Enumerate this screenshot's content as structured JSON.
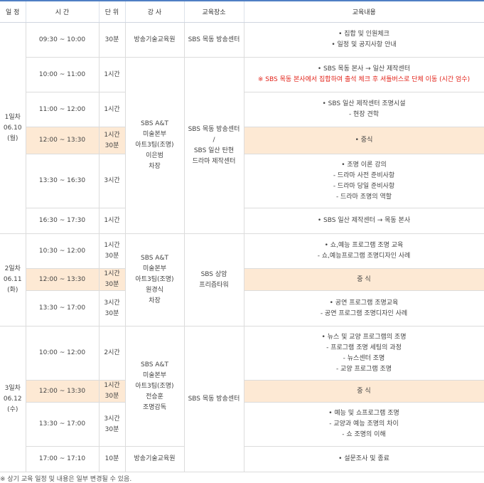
{
  "headers": {
    "day": "일 정",
    "time": "시 간",
    "unit": "단 위",
    "instructor": "강 사",
    "location": "교육장소",
    "content": "교육내용"
  },
  "day1": {
    "day_lines": [
      "1일차",
      "06.10",
      "(월)"
    ],
    "rows": [
      {
        "time": "09:30 ~ 10:00",
        "unit_lines": [
          "30분"
        ],
        "content": [
          "• 집합 및 인원체크",
          "• 일정 및 공지사항 안내"
        ]
      },
      {
        "time": "10:00 ~ 11:00",
        "unit_lines": [
          "1시간"
        ],
        "content": [
          "• SBS 목동 본사 → 일산 제작센터"
        ],
        "content_red": "※ SBS 목동 본사에서 집합하여 출석 체크 후 셔틀버스로 단체 이동 (시간 엄수)"
      },
      {
        "time": "11:00 ~ 12:00",
        "unit_lines": [
          "1시간"
        ],
        "content": [
          "• SBS 일산 제작센터 조명시설",
          "- 현장 견학"
        ]
      },
      {
        "time": "12:00 ~ 13:30",
        "unit_lines": [
          "1시간",
          "30분"
        ],
        "content": [
          "• 중식"
        ]
      },
      {
        "time": "13:30 ~ 16:30",
        "unit_lines": [
          "3시간"
        ],
        "content": [
          "• 조명 이론 강의",
          "- 드라마 사전 준비사항",
          "- 드라마 당일 준비사항",
          "- 드라마 조명의 역할"
        ]
      },
      {
        "time": "16:30 ~ 17:30",
        "unit_lines": [
          "1시간"
        ],
        "content": [
          "• SBS 일산 제작센터 → 목동 본사"
        ]
      }
    ],
    "first_instructor": "방송기술교육원",
    "first_location": "SBS 목동 방송센터",
    "instructor_lines": [
      "SBS A&T",
      "미술본부",
      "아트3팀(조명)",
      "이은범",
      "차장"
    ],
    "location_lines": [
      "SBS 목동 방송센터",
      "/",
      "SBS 일산 탄현",
      "드라마 제작센터"
    ]
  },
  "day2": {
    "day_lines": [
      "2일차",
      "06.11",
      "(화)"
    ],
    "rows": [
      {
        "time": "10:30 ~ 12:00",
        "unit_lines": [
          "1시간",
          "30분"
        ],
        "content": [
          "• 쇼,예능 프로그램 조명 교육",
          "- 쇼,예능프로그램 조명디자인 사례"
        ]
      },
      {
        "time": "12:00 ~ 13:30",
        "unit_lines": [
          "1시간",
          "30분"
        ],
        "content": [
          "중 식"
        ]
      },
      {
        "time": "13:30 ~ 17:00",
        "unit_lines": [
          "3시간",
          "30분"
        ],
        "content": [
          "• 공연 프로그램 조명교육",
          "- 공연 프로그램 조명디자인 사례"
        ]
      }
    ],
    "instructor_lines": [
      "SBS A&T",
      "미술본부",
      "아트3팀(조명)",
      "원경식",
      "차장"
    ],
    "location_lines": [
      "SBS 상암",
      "프리즘타워"
    ]
  },
  "day3": {
    "day_lines": [
      "3일차",
      "06.12",
      "(수)"
    ],
    "rows": [
      {
        "time": "10:00 ~ 12:00",
        "unit_lines": [
          "2시간"
        ],
        "content": [
          "• 뉴스 및 교양 프로그램의 조명",
          "- 프로그램 조명 세팅의 과정",
          "- 뉴스센터 조명",
          "- 교양 프로그램 조명"
        ]
      },
      {
        "time": "12:00 ~ 13:30",
        "unit_lines": [
          "1시간",
          "30분"
        ],
        "content": [
          "중 식"
        ]
      },
      {
        "time": "13:30 ~ 17:00",
        "unit_lines": [
          "3시간",
          "30분"
        ],
        "content": [
          "• 예능 및 쇼프로그램 조명",
          "- 교양과 예능 조명의 차이",
          "- 쇼 조명의 이해"
        ]
      },
      {
        "time": "17:00 ~ 17:10",
        "unit_lines": [
          "10분"
        ],
        "content": [
          "• 설문조사 및 종료"
        ]
      }
    ],
    "instructor_lines": [
      "SBS A&T",
      "미술본부",
      "아트3팀(조명)",
      "전승훈",
      "조명감독"
    ],
    "last_instructor": "방송기술교육원",
    "location": "SBS 목동 방송센터"
  },
  "note": "※ 상기 교육 일정 및 내용은 일부 변경될 수 있음.",
  "colors": {
    "header_line": "#4f7fc4",
    "lunch_bg": "#fde9d4",
    "notice_red": "#e2231a",
    "border": "#dcdcdc"
  }
}
